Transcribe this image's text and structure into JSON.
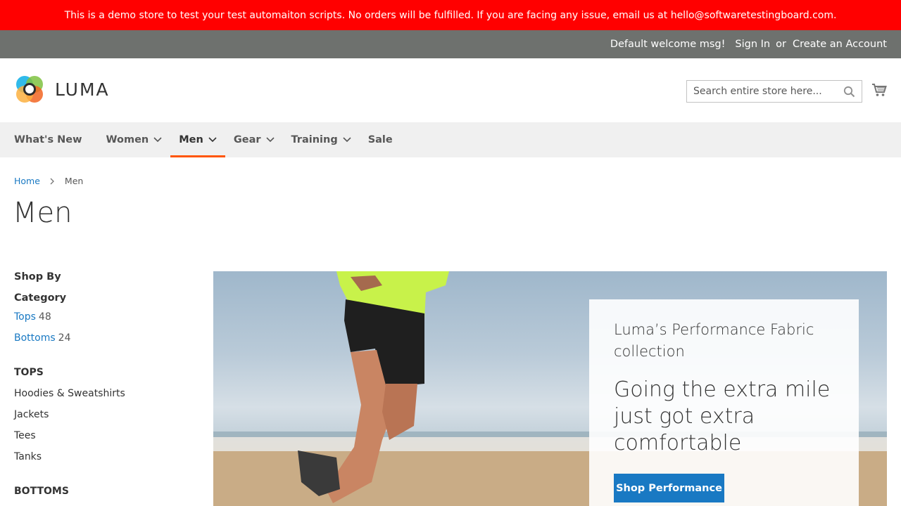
{
  "demo_notice": "This is a demo store to test your test automaiton scripts. No orders will be fulfilled. If you are facing any issue, email us at hello@softwaretestingboard.com.",
  "panel": {
    "welcome": "Default welcome msg!",
    "sign_in": "Sign In",
    "or": "or",
    "create_account": "Create an Account"
  },
  "header": {
    "logo_text": "LUMA",
    "search_placeholder": "Search entire store here..."
  },
  "nav": {
    "items": [
      {
        "label": "What's New"
      },
      {
        "label": "Women"
      },
      {
        "label": "Men"
      },
      {
        "label": "Gear"
      },
      {
        "label": "Training"
      },
      {
        "label": "Sale"
      }
    ]
  },
  "breadcrumb": {
    "home": "Home",
    "current": "Men"
  },
  "page_title": "Men",
  "sidebar": {
    "title": "Shop By",
    "category_label": "Category",
    "categories": [
      {
        "label": "Tops",
        "count": "48"
      },
      {
        "label": "Bottoms",
        "count": "24"
      }
    ],
    "tops_heading": "TOPS",
    "tops_items": [
      "Hoodies & Sweatshirts",
      "Jackets",
      "Tees",
      "Tanks"
    ],
    "bottoms_heading": "BOTTOMS"
  },
  "hero": {
    "subtitle": "Luma’s Performance Fabric collection",
    "headline": "Going the extra mile just got extra comfortable",
    "button": "Shop Performance"
  },
  "colors": {
    "demo_bar": "#ff0000",
    "panel": "#6e716e",
    "link": "#1979c3",
    "nav_active": "#ff5501"
  }
}
